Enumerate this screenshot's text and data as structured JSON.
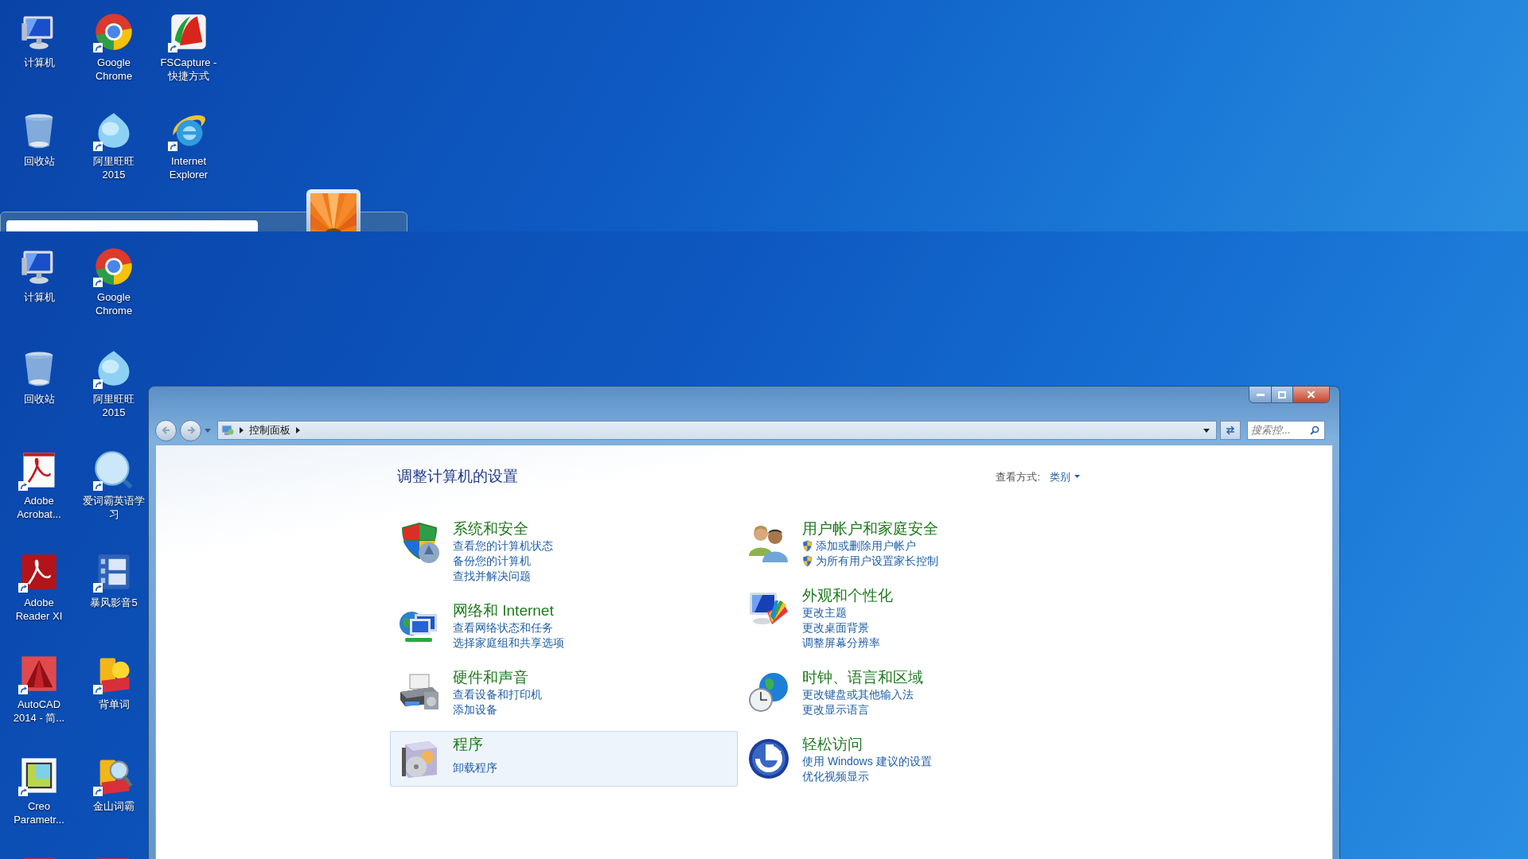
{
  "top_desktop": {
    "icons": [
      {
        "kind": "computer",
        "label": [
          "计算机"
        ],
        "shortcut": false
      },
      {
        "kind": "chrome",
        "label": [
          "Google",
          "Chrome"
        ],
        "shortcut": true
      },
      {
        "kind": "fscapture",
        "label": [
          "FSCapture -",
          "快捷方式"
        ],
        "shortcut": true
      },
      {
        "kind": "recycle",
        "label": [
          "回收站"
        ],
        "shortcut": false
      },
      {
        "kind": "wangwang",
        "label": [
          "阿里旺旺",
          "2015"
        ],
        "shortcut": true
      },
      {
        "kind": "ie",
        "label": [
          "Internet",
          "Explorer"
        ],
        "shortcut": true
      }
    ]
  },
  "desktop": {
    "icons": [
      {
        "kind": "computer",
        "label": [
          "计算机"
        ],
        "shortcut": false
      },
      {
        "kind": "chrome",
        "label": [
          "Google",
          "Chrome"
        ],
        "shortcut": true
      },
      {
        "kind": "recycle",
        "label": [
          "回收站"
        ],
        "shortcut": false
      },
      {
        "kind": "wangwang",
        "label": [
          "阿里旺旺",
          "2015"
        ],
        "shortcut": true
      },
      {
        "kind": "acrobat",
        "label": [
          "Adobe",
          "Acrobat..."
        ],
        "shortcut": true
      },
      {
        "kind": "iciba",
        "label": [
          "爱词霸英语学",
          "习"
        ],
        "shortcut": true
      },
      {
        "kind": "reader",
        "label": [
          "Adobe",
          "Reader XI"
        ],
        "shortcut": true
      },
      {
        "kind": "baofeng",
        "label": [
          "暴风影音5"
        ],
        "shortcut": true
      },
      {
        "kind": "autocad",
        "label": [
          "AutoCAD",
          "2014 - 简..."
        ],
        "shortcut": true
      },
      {
        "kind": "beidanci",
        "label": [
          "背单词"
        ],
        "shortcut": true
      },
      {
        "kind": "creo",
        "label": [
          "Creo",
          "Parametr..."
        ],
        "shortcut": true
      },
      {
        "kind": "jinshan",
        "label": [
          "金山词霸"
        ],
        "shortcut": true
      },
      {
        "kind": "redapp"
      },
      {
        "kind": "redapp"
      }
    ]
  },
  "window": {
    "address": {
      "crumbs": [
        "控制面板"
      ]
    },
    "search": {
      "placeholder": "搜索控..."
    },
    "heading": "调整计算机的设置",
    "view_by": {
      "label": "查看方式:",
      "value": "类别"
    },
    "category_columns": [
      {
        "categories": [
          {
            "kind": "system",
            "title": "系统和安全",
            "selected": false,
            "links": [
              {
                "text": "查看您的计算机状态",
                "shield": false
              },
              {
                "text": "备份您的计算机",
                "shield": false
              },
              {
                "text": "查找并解决问题",
                "shield": false
              }
            ]
          },
          {
            "kind": "network",
            "title": "网络和 Internet",
            "selected": false,
            "links": [
              {
                "text": "查看网络状态和任务",
                "shield": false
              },
              {
                "text": "选择家庭组和共享选项",
                "shield": false
              }
            ]
          },
          {
            "kind": "hardware",
            "title": "硬件和声音",
            "selected": false,
            "links": [
              {
                "text": "查看设备和打印机",
                "shield": false
              },
              {
                "text": "添加设备",
                "shield": false
              }
            ]
          },
          {
            "kind": "programs",
            "title": "程序",
            "selected": true,
            "links": [
              {
                "text": "卸载程序",
                "shield": false
              }
            ]
          }
        ]
      },
      {
        "categories": [
          {
            "kind": "users",
            "title": "用户帐户和家庭安全",
            "selected": false,
            "links": [
              {
                "text": "添加或删除用户帐户",
                "shield": true
              },
              {
                "text": "为所有用户设置家长控制",
                "shield": true
              }
            ]
          },
          {
            "kind": "appearance",
            "title": "外观和个性化",
            "selected": false,
            "links": [
              {
                "text": "更改主题",
                "shield": false
              },
              {
                "text": "更改桌面背景",
                "shield": false
              },
              {
                "text": "调整屏幕分辨率",
                "shield": false
              }
            ]
          },
          {
            "kind": "clock",
            "title": "时钟、语言和区域",
            "selected": false,
            "links": [
              {
                "text": "更改键盘或其他输入法",
                "shield": false
              },
              {
                "text": "更改显示语言",
                "shield": false
              }
            ]
          },
          {
            "kind": "access",
            "title": "轻松访问",
            "selected": false,
            "links": [
              {
                "text": "使用 Windows 建议的设置",
                "shield": false
              },
              {
                "text": "优化视频显示",
                "shield": false
              }
            ]
          }
        ]
      }
    ]
  }
}
